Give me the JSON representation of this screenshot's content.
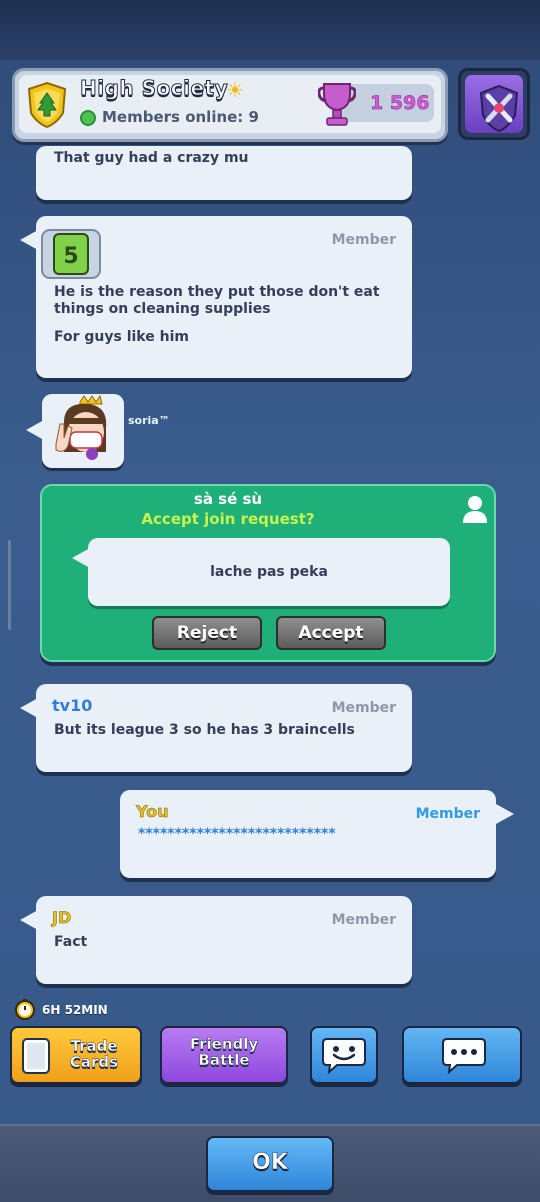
{
  "header": {
    "clan_name": "High Society",
    "sun_icon": "☀",
    "members_online": "Members online: 9",
    "trophies": "1 596"
  },
  "chat": {
    "partial_message": "That guy had a crazy mu",
    "level_badge": "5",
    "messages": [
      {
        "role": "Member",
        "lines": [
          "He is the reason they put those don't eat",
          "things on cleaning supplies",
          "For guys like him"
        ]
      },
      {
        "sender": "tv10",
        "role": "Member",
        "text": "But its league 3 so he has 3 braincells"
      },
      {
        "sender": "You",
        "role": "Member",
        "text": "***************************"
      },
      {
        "sender": "JD",
        "role": "Member",
        "text": "Fact"
      }
    ],
    "avatar_name": "soria™"
  },
  "join_request": {
    "name": "sà sé sù",
    "question": "Accept join request?",
    "message": "lache pas peka",
    "reject_label": "Reject",
    "accept_label": "Accept"
  },
  "actions": {
    "timer": "6H 52MIN",
    "trade_cards": "Trade\nCards",
    "friendly_battle": "Friendly\nBattle"
  },
  "footer": {
    "ok_label": "OK"
  },
  "colors": {
    "accent_green": "#1fb07a",
    "trophy_pink": "#d35ad7",
    "sender_blue": "#2f7fd8",
    "you_yellow": "#e8c21a"
  }
}
